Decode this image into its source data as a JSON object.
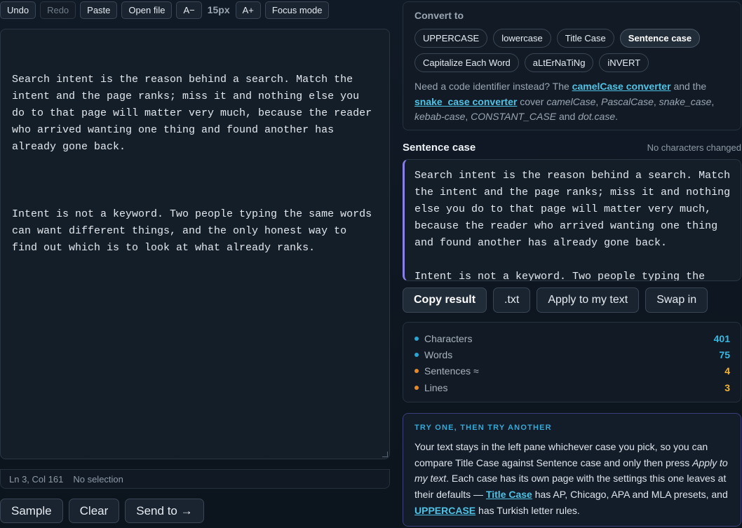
{
  "toolbar": {
    "undo": "Undo",
    "redo": "Redo",
    "paste": "Paste",
    "open_file": "Open file",
    "font_decrease": "A−",
    "font_size": "15px",
    "font_increase": "A+",
    "focus_mode": "Focus mode"
  },
  "editor": {
    "paragraph1": "Search intent is the reason behind a search. Match the intent and the page ranks; miss it and nothing else you do to that page will matter very much, because the reader who arrived wanting one thing and found another has already gone back.",
    "paragraph2": "Intent is not a keyword. Two people typing the same words can want different things, and the only honest way to find out which is to look at what already ranks."
  },
  "statusbar": {
    "position": "Ln 3, Col 161",
    "selection": "No selection"
  },
  "bottom_actions": {
    "sample": "Sample",
    "clear": "Clear",
    "send_to": "Send to →"
  },
  "convert": {
    "title": "Convert to",
    "options": [
      "UPPERCASE",
      "lowercase",
      "Title Case",
      "Sentence case",
      "Capitalize Each Word",
      "aLtErNaTiNg",
      "iNVERT"
    ],
    "active_index": 3,
    "note_prefix": "Need a code identifier instead? The",
    "link_camel": "camelCase converter",
    "note_and": "and the",
    "link_snake": "snake_case converter",
    "note_cover": "cover",
    "cases_list": [
      "camelCase",
      "PascalCase",
      "snake_case",
      "kebab-case",
      "CONSTANT_CASE",
      "dot.case"
    ],
    "note_and2": "and"
  },
  "result": {
    "title": "Sentence case",
    "status": "No characters changed",
    "paragraph1": "Search intent is the reason behind a search. Match the intent and the page ranks; miss it and nothing else you do to that page will matter very much, because the reader who arrived wanting one thing and found another has already gone back.",
    "paragraph2": "Intent is not a keyword. Two people typing the same words can want different things, and the only honest way to find out which is to look at what already ranks.",
    "copy": "Copy result",
    "txt": ".txt",
    "apply": "Apply to my text",
    "swap": "Swap in"
  },
  "stats": [
    {
      "label": "Characters",
      "value": "401",
      "dot": "#2aa6d4",
      "color": "#39b9e3"
    },
    {
      "label": "Words",
      "value": "75",
      "dot": "#2aa6d4",
      "color": "#39b9e3"
    },
    {
      "label": "Sentences ≈",
      "value": "4",
      "dot": "#e58a2a",
      "color": "#f2b43a"
    },
    {
      "label": "Lines",
      "value": "3",
      "dot": "#e58a2a",
      "color": "#f2b43a"
    }
  ],
  "tip": {
    "title": "TRY ONE, THEN TRY ANOTHER",
    "text1": "Your text stays in the left pane whichever case you pick, so you can compare Title Case against Sentence case and only then press",
    "apply_italic": "Apply to my text",
    "text2": ". Each case has its own page with the settings this one leaves at their defaults —",
    "link_title": "Title Case",
    "text3": "has AP, Chicago, APA and MLA presets, and",
    "link_upper": "UPPERCASE",
    "text4": "has Turkish letter rules."
  }
}
